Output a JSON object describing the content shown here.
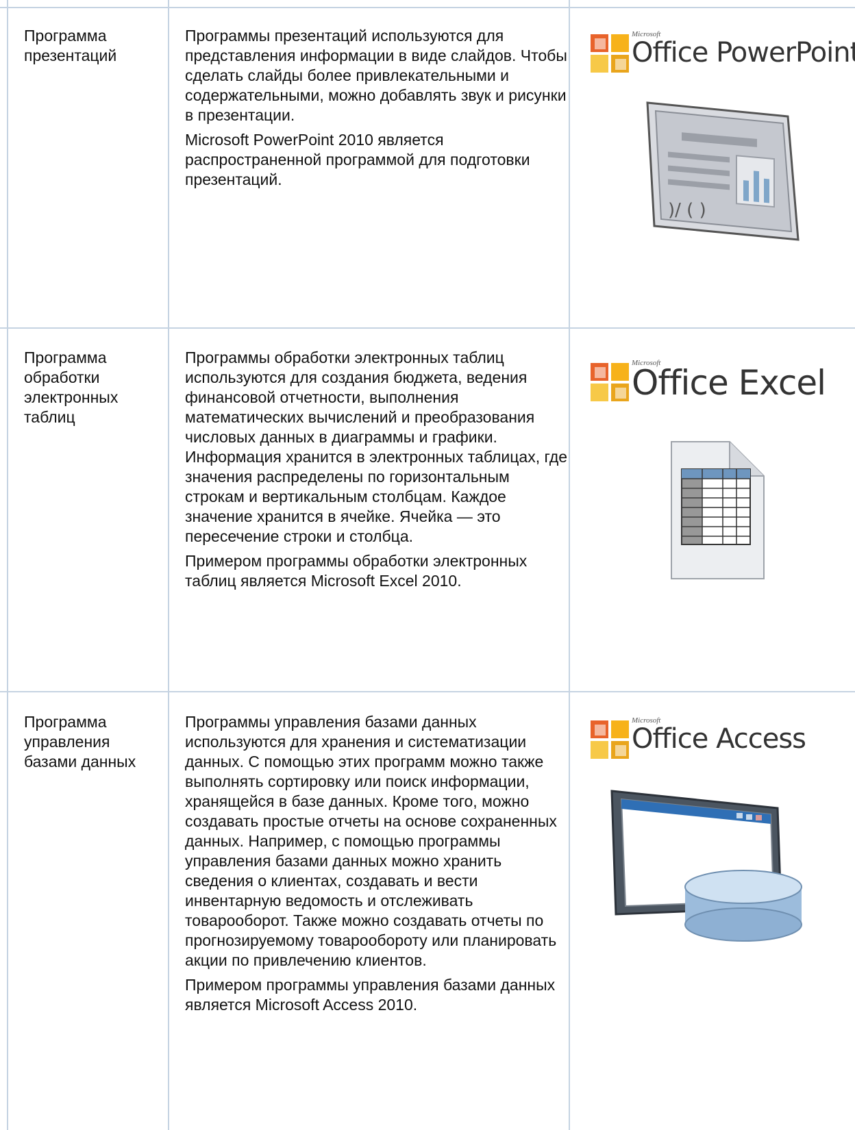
{
  "rows": [
    {
      "category": "Программа презентаций",
      "description": [
        "Программы презентаций используются для представления информации в виде слайдов. Чтобы сделать слайды более привлекательными и содержательными, можно добавлять звук и рисунки в презентации.",
        "Microsoft PowerPoint 2010 является распространенной программой для подготовки презентаций."
      ],
      "logo": {
        "microsoft": "Microsoft",
        "product": "Office PowerPoint",
        "icon": "office-logo-icon"
      },
      "illustration": "slide-icon"
    },
    {
      "category": "Программа обработки электронных таблиц",
      "description": [
        "Программы обработки электронных таблиц используются для создания бюджета, ведения финансовой отчетности, выполнения математических вычислений и преобразования числовых данных в диаграммы и графики. Информация хранится в электронных таблицах, где значения распределены по горизонтальным строкам и вертикальным столбцам. Каждое значение хранится в ячейке. Ячейка — это пересечение строки и столбца.",
        "Примером программы обработки электронных таблиц является Microsoft Excel 2010."
      ],
      "logo": {
        "microsoft": "Microsoft",
        "product": "Office Excel",
        "icon": "office-logo-icon"
      },
      "illustration": "spreadsheet-document-icon"
    },
    {
      "category": "Программа управления базами данных",
      "description": [
        "Программы управления базами данных используются для хранения и систематизации данных. С помощью этих программ можно также выполнять сортировку или поиск информации, хранящейся в базе данных. Кроме того, можно создавать простые отчеты на основе сохраненных данных. Например, с помощью программы управления базами данных можно хранить сведения о клиентах, создавать и вести инвентарную ведомость и отслеживать товарооборот. Также можно создавать отчеты по прогнозируемому товарообороту или планировать акции по привлечению клиентов.",
        "Примером программы управления базами данных является Microsoft Access 2010."
      ],
      "logo": {
        "microsoft": "Microsoft",
        "product": "Office Access",
        "icon": "office-logo-icon"
      },
      "illustration": "database-window-icon"
    }
  ]
}
